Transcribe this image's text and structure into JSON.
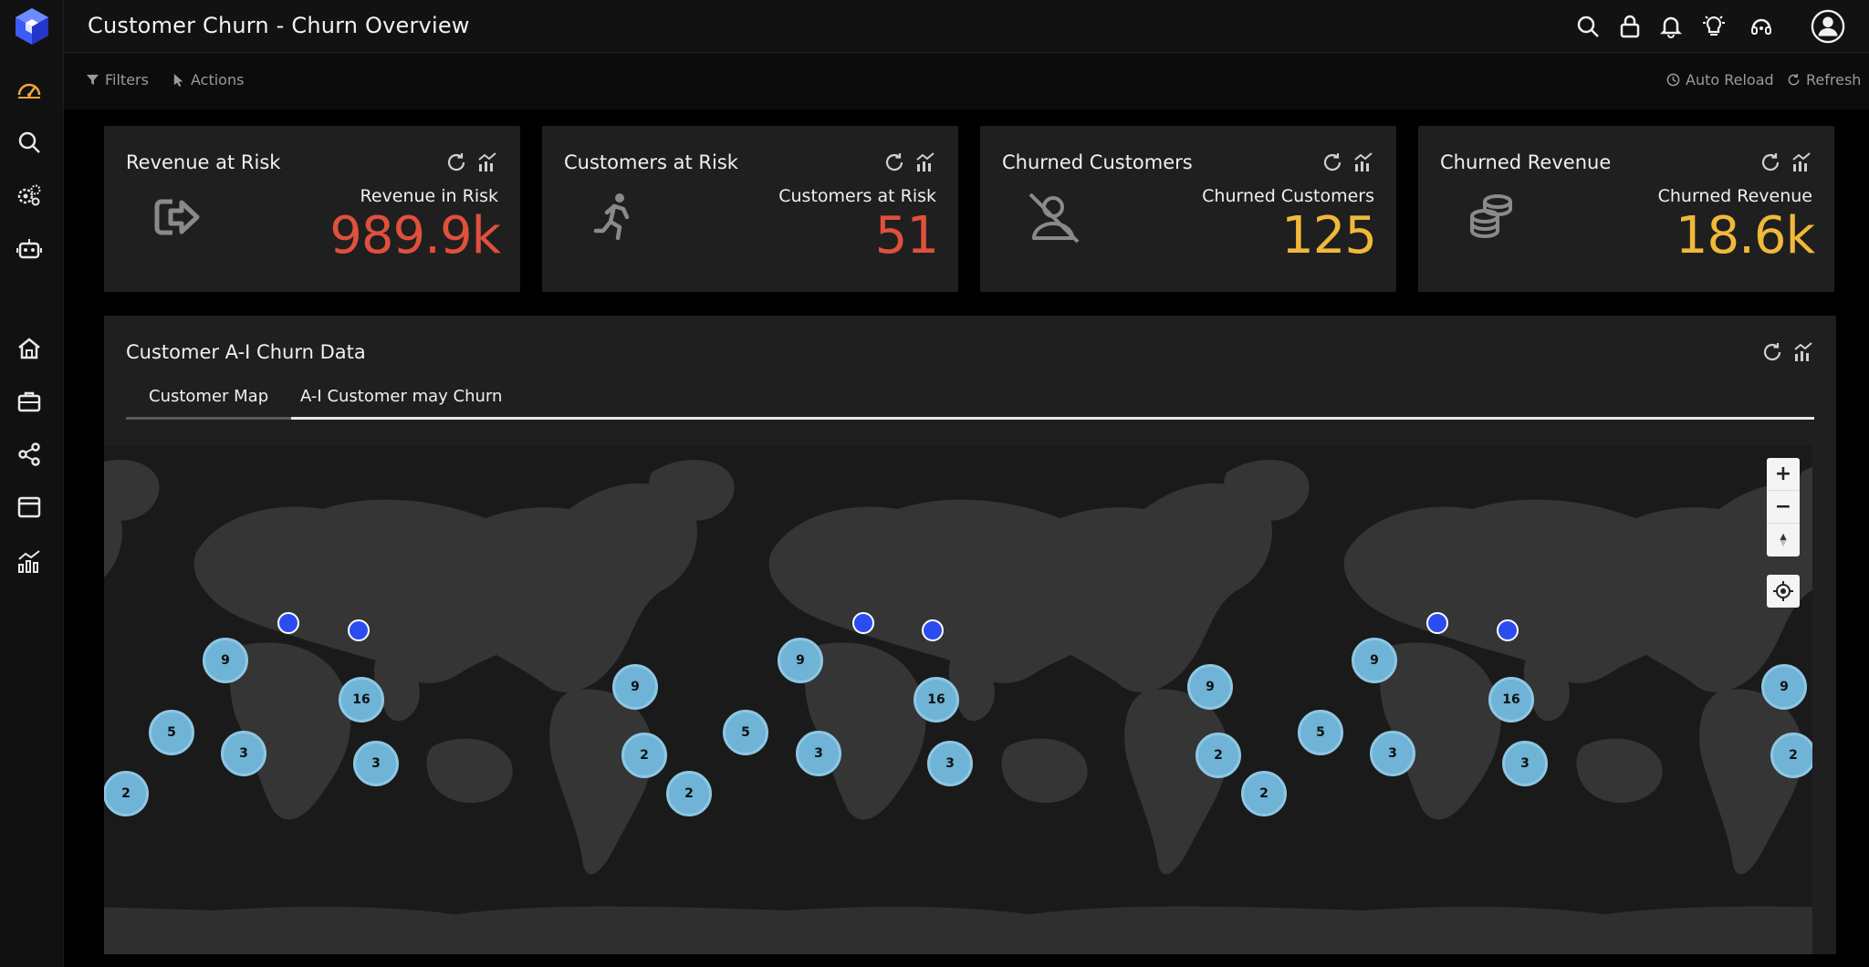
{
  "app": {
    "title": "Customer Churn - Churn Overview"
  },
  "sidebar": {
    "items": [
      {
        "icon": "dashboard-gauge-icon",
        "active": true
      },
      {
        "icon": "search-icon"
      },
      {
        "icon": "settings-gears-icon"
      },
      {
        "icon": "robot-icon"
      },
      {
        "icon": "home-icon"
      },
      {
        "icon": "briefcase-icon"
      },
      {
        "icon": "share-icon"
      },
      {
        "icon": "window-icon"
      },
      {
        "icon": "analytics-chart-icon"
      }
    ]
  },
  "header": {
    "icons": [
      "search-icon",
      "lock-icon",
      "bell-icon",
      "lightbulb-icon",
      "support-headset-icon",
      "user-avatar-icon"
    ]
  },
  "toolbar": {
    "filters_label": "Filters",
    "actions_label": "Actions",
    "auto_reload_label": "Auto Reload",
    "refresh_label": "Refresh"
  },
  "kpis": [
    {
      "title": "Revenue at Risk",
      "label": "Revenue in Risk",
      "value": "989.9k",
      "color": "#e0503c",
      "icon": "export-arrow-icon"
    },
    {
      "title": "Customers at Risk",
      "label": "Customers at Risk",
      "value": "51",
      "color": "#e0503c",
      "icon": "running-person-icon"
    },
    {
      "title": "Churned Customers",
      "label": "Churned Customers",
      "value": "125",
      "color": "#f0b93a",
      "icon": "user-slash-icon"
    },
    {
      "title": "Churned Revenue",
      "label": "Churned Revenue",
      "value": "18.6k",
      "color": "#f0b93a",
      "icon": "coins-stack-icon"
    }
  ],
  "panel": {
    "title": "Customer A-I Churn Data",
    "tabs": [
      {
        "label": "Customer Map",
        "active": true
      },
      {
        "label": "A-I Customer may Churn",
        "active": false
      }
    ]
  },
  "map": {
    "clusters": [
      "9",
      "5",
      "3",
      "16",
      "3",
      "2",
      "9",
      "2",
      "2",
      "9",
      "5",
      "3",
      "16",
      "3",
      "9",
      "2",
      "2",
      "9",
      "5",
      "3",
      "16",
      "3",
      "9",
      "2"
    ],
    "controls": [
      "+",
      "−"
    ]
  }
}
